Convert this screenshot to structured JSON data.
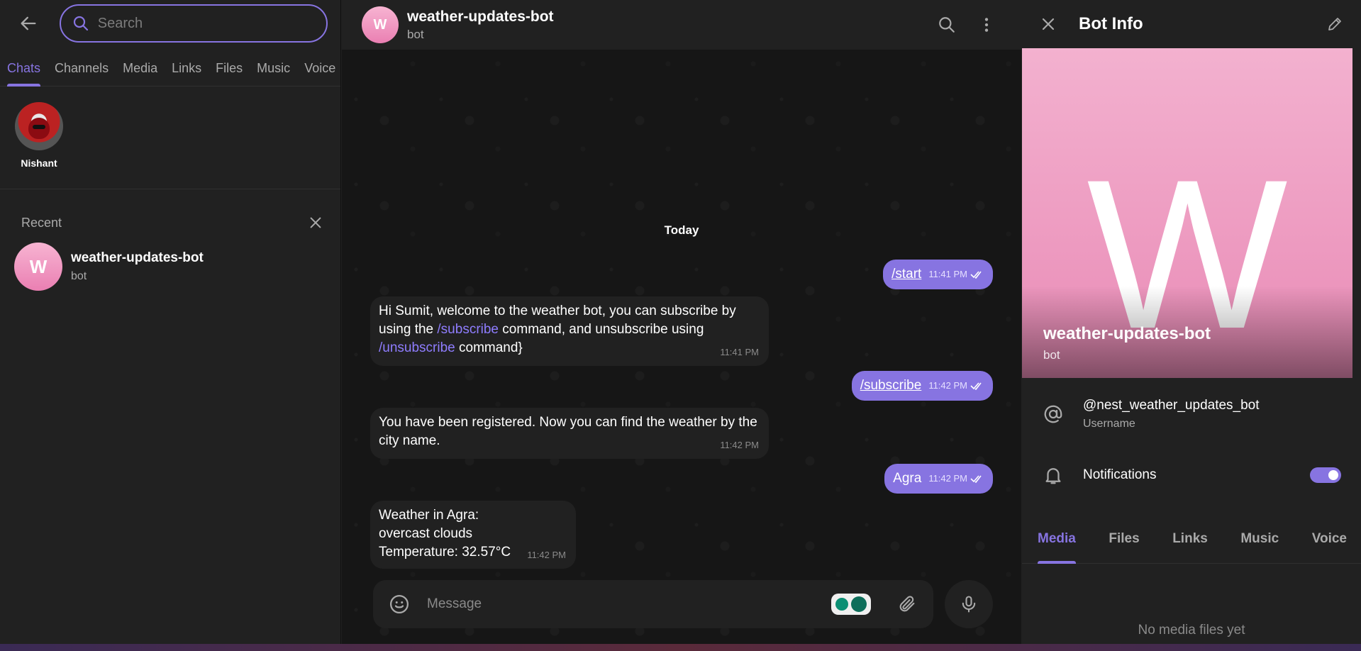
{
  "left": {
    "search": {
      "placeholder": "Search"
    },
    "tabs": [
      "Chats",
      "Channels",
      "Media",
      "Links",
      "Files",
      "Music",
      "Voice"
    ],
    "people": [
      {
        "name": "Nishant"
      }
    ],
    "recent": {
      "label": "Recent",
      "items": [
        {
          "avatar_letter": "W",
          "name": "weather-updates-bot",
          "subtitle": "bot"
        }
      ]
    }
  },
  "chat": {
    "header": {
      "avatar_letter": "W",
      "title": "weather-updates-bot",
      "subtitle": "bot"
    },
    "date": "Today",
    "messages": [
      {
        "dir": "out",
        "text": "/start",
        "time": "11:41 PM"
      },
      {
        "dir": "in",
        "parts": [
          "Hi Sumit, welcome to the weather bot, you can subscribe by using the ",
          "/subscribe",
          " command, and unsubscribe using ",
          "/unsubscribe",
          " command}"
        ],
        "time": "11:41 PM"
      },
      {
        "dir": "out",
        "text": "/subscribe",
        "time": "11:42 PM"
      },
      {
        "dir": "in",
        "text": "You have been registered. Now you can find the weather by the city name.",
        "time": "11:42 PM"
      },
      {
        "dir": "out",
        "text": "Agra",
        "time": "11:42 PM"
      },
      {
        "dir": "in",
        "lines": [
          "Weather in Agra:",
          "overcast clouds",
          "Temperature: 32.57°C"
        ],
        "time": "11:42 PM"
      }
    ],
    "composer": {
      "placeholder": "Message"
    }
  },
  "right": {
    "title": "Bot Info",
    "avatar_letter": "W",
    "name": "weather-updates-bot",
    "subtitle": "bot",
    "username": "@nest_weather_updates_bot",
    "username_label": "Username",
    "notifications_label": "Notifications",
    "notifications_on": true,
    "tabs": [
      "Media",
      "Files",
      "Links",
      "Music",
      "Voice"
    ],
    "empty_text": "No media files yet"
  },
  "colors": {
    "accent": "#8774e1",
    "panel": "#212121",
    "chat_bg": "#161616",
    "avatar_pink": "#ea7fb2"
  },
  "icons": [
    "back-arrow-icon",
    "search-icon",
    "close-icon",
    "more-vertical-icon",
    "emoji-icon",
    "attach-icon",
    "mic-icon",
    "edit-icon",
    "at-icon",
    "bell-icon",
    "double-check-icon"
  ]
}
